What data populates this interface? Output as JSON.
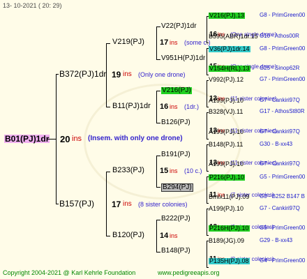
{
  "colors": {
    "bg": "#fffce8",
    "ins_red": "#cc0000",
    "note_blue": "#3322cc",
    "info_blue": "#1a1acc",
    "green_hl": "#21d021",
    "cyan_hl": "#33cccc",
    "gray_hl": "#b8b8b8",
    "pink_hl": "#f0b0f0"
  },
  "timestamp": "13- 10-2021 ( 20: 29)",
  "copyright": "Copyright 2004-2021 @ Karl Kehrle Foundation",
  "site": "www.pedigreeapis.org",
  "root": {
    "name": "B01(PJ)1dr",
    "ins": "20",
    "ins_label": "ins",
    "note": "(Insem. with only one drone)"
  },
  "g2": [
    {
      "name": "B372(PJ)1dr",
      "ins": "19",
      "ins_label": "ins",
      "note": "(Only one drone)"
    },
    {
      "name": "B157(PJ)",
      "ins": "17",
      "ins_label": "ins",
      "note": "(8 sister colonies)"
    }
  ],
  "g3": [
    {
      "name": "V219(PJ)",
      "ins": "17",
      "ins_label": "ins",
      "note": "(some c.)"
    },
    {
      "name": "B11(PJ)1dr",
      "ins": "16",
      "ins_label": "ins",
      "note": "(1dr.)"
    },
    {
      "name": "B233(PJ)",
      "ins": "15",
      "ins_label": "ins",
      "note": "(10 c.)"
    },
    {
      "name": "B120(PJ)",
      "ins": "14",
      "ins_label": "ins",
      "note": ""
    }
  ],
  "g4": [
    {
      "name": "V22(PJ)1dr",
      "ins": "16",
      "ins_label": "ins",
      "note": "(One single drone)"
    },
    {
      "name": "V951H(PJ)1dr",
      "ins": "15",
      "ins_label": "ins",
      "note": "(One single drone)"
    },
    {
      "name": "V216(PJ)",
      "ins": "13",
      "ins_label": "ins",
      "note": "(11 sister colonies)"
    },
    {
      "name": "B126(PJ)",
      "ins": "13",
      "ins_label": "ins",
      "note": "(11 sister colonies)"
    },
    {
      "name": "B191(PJ)",
      "ins": "13",
      "ins_label": "ins",
      "note": "(11 sister colonies)"
    },
    {
      "name": "B294(PJ)",
      "ins": "11",
      "ins_label": "ins",
      "note": "(7 sister colonies)"
    },
    {
      "name": "B222(PJ)",
      "ins": "12",
      "ins_label": "ins",
      "note": "(9 sister colonies)"
    },
    {
      "name": "B148(PJ)",
      "ins": "11",
      "ins_label": "ins",
      "note": "(8 sister colonies)"
    }
  ],
  "g5": [
    {
      "name": "V216(PJ).13",
      "info": "G8 - PrimGreen00"
    },
    {
      "name": "B595(ABR)1dr.15",
      "info": "G10 - Athos00R"
    },
    {
      "name": "V36(PJ)1dr.14",
      "info": "G8 - PrimGreen00"
    },
    {
      "name": "V154H(RL).13",
      "info": "G25 - Sinop62R"
    },
    {
      "name": "V992(PJ).12",
      "info": "G7 - PrimGreen00"
    },
    {
      "name": "A199(PJ).10",
      "info": "G7 - Cankiri97Q"
    },
    {
      "name": "B328(VJ).11",
      "info": "G17 - AthosSt80R"
    },
    {
      "name": "A199(PJ).10",
      "info": "G7 - Cankiri97Q"
    },
    {
      "name": "B148(PJ).11",
      "info": "G30 - B-xx43"
    },
    {
      "name": "A199(PJ).10",
      "info": "G7 - Cankiri97Q"
    },
    {
      "name": "P216(PJ).10",
      "info": "G5 - PrimGreen00"
    },
    {
      "name": "Bmix11(PJ).09",
      "info": "G0 - B252 B147 B"
    },
    {
      "name": "A199(PJ).10",
      "info": "G7 - Cankiri97Q"
    },
    {
      "name": "P216H(PJ).10",
      "info": "G5 - PrimGreen00"
    },
    {
      "name": "B189(JG).09",
      "info": "G29 - B-xx43"
    },
    {
      "name": "P135H(PJ).08",
      "info": "G4 - PrimGreen00"
    }
  ]
}
